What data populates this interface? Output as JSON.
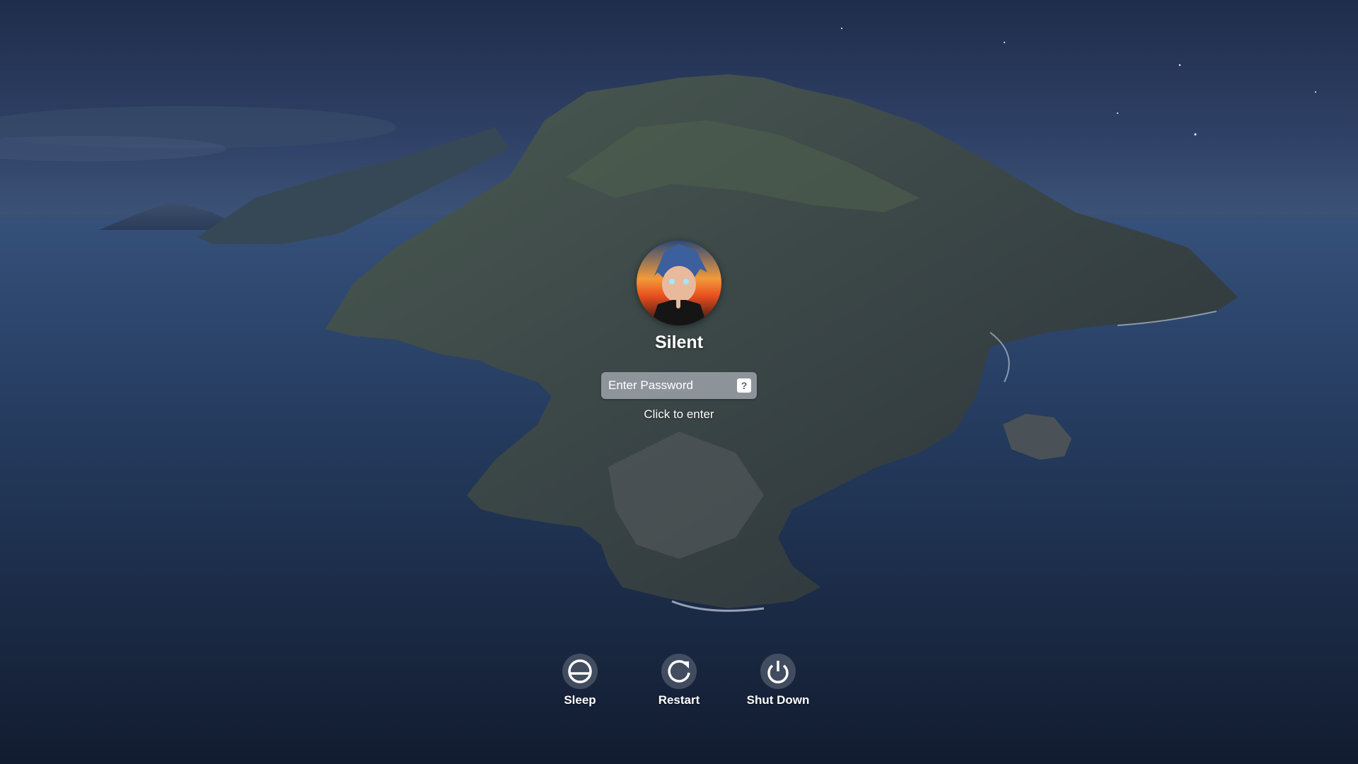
{
  "user": {
    "name": "Silent"
  },
  "password": {
    "placeholder": "Enter Password",
    "value": "",
    "hint_label": "?"
  },
  "click_hint": "Click to enter",
  "power_actions": [
    {
      "label": "Sleep",
      "icon": "sleep-icon"
    },
    {
      "label": "Restart",
      "icon": "restart-icon"
    },
    {
      "label": "Shut Down",
      "icon": "power-icon"
    }
  ],
  "colors": {
    "sky": "#2f4166",
    "sea": "#1f3050",
    "text": "#ffffff"
  }
}
